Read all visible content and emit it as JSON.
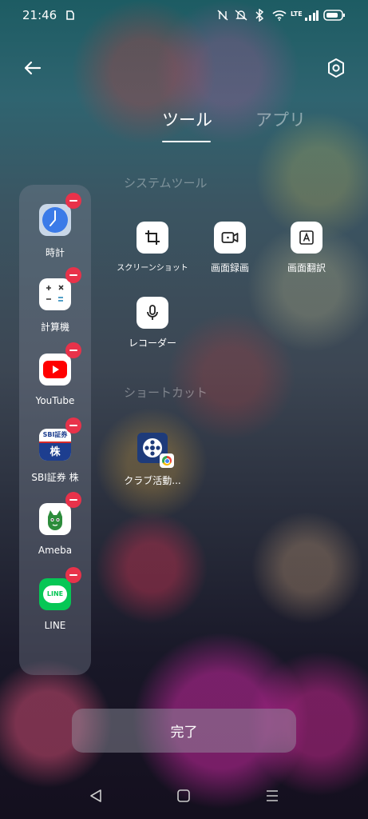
{
  "status_bar": {
    "time": "21:46",
    "network": "LTE"
  },
  "header": {
    "back_icon": "arrow-left-icon",
    "settings_icon": "gear-icon"
  },
  "tabs": [
    {
      "label": "ツール",
      "active": true
    },
    {
      "label": "アプリ",
      "active": false
    }
  ],
  "sections": {
    "system_tools": "システムツール",
    "shortcuts": "ショートカット"
  },
  "system_tools": [
    {
      "label": "スクリーンショット",
      "icon": "crop-icon"
    },
    {
      "label": "画面録画",
      "icon": "video-record-icon"
    },
    {
      "label": "画面翻訳",
      "icon": "translate-icon"
    },
    {
      "label": "レコーダー",
      "icon": "microphone-icon"
    }
  ],
  "shortcuts": [
    {
      "label": "クラブ活動...",
      "icon": "video-reel-icon"
    }
  ],
  "sidebar_apps": [
    {
      "label": "時計",
      "icon": "clock-icon"
    },
    {
      "label": "計算機",
      "icon": "calculator-icon"
    },
    {
      "label": "YouTube",
      "icon": "youtube-icon"
    },
    {
      "label": "SBI証券 株",
      "icon": "sbi-icon",
      "icon_text": "SBI証券",
      "icon_sub": "株"
    },
    {
      "label": "Ameba",
      "icon": "ameba-icon"
    },
    {
      "label": "LINE",
      "icon": "line-icon",
      "icon_text": "LINE"
    }
  ],
  "done_button": "完了",
  "colors": {
    "remove_badge": "#e8324a",
    "youtube": "#ff0000",
    "line": "#06c755",
    "sbi_blue": "#1d3e8f"
  }
}
